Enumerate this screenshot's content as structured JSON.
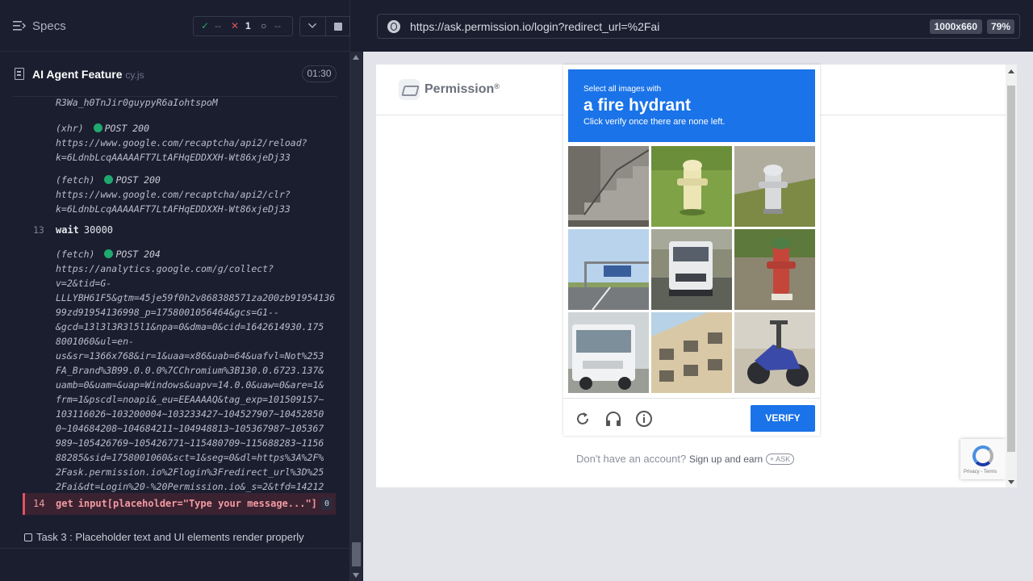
{
  "reporter": {
    "specs_label": "Specs",
    "stats": {
      "passed": "--",
      "failed": "1",
      "pending": "--"
    },
    "spec_file": {
      "name": "AI Agent Feature",
      "ext": "cy.js",
      "duration": "01:30"
    },
    "log": [
      {
        "type": "text",
        "text": "R3Wa_h0TnJir0guypyR6aIohtspoM"
      },
      {
        "type": "req",
        "label": "(xhr)",
        "status": "POST 200"
      },
      {
        "type": "text",
        "text": "https://www.google.com/recaptcha/api2/reload?"
      },
      {
        "type": "text",
        "text": "k=6LdnbLcqAAAAAFT7LtAFHqEDDXXH-Wt86xjeDj33"
      },
      {
        "type": "req",
        "label": "(fetch)",
        "status": "POST 200"
      },
      {
        "type": "text",
        "text": "https://www.google.com/recaptcha/api2/clr?"
      },
      {
        "type": "text",
        "text": "k=6LdnbLcqAAAAAFT7LtAFHqEDDXXH-Wt86xjeDj33"
      },
      {
        "type": "cmd",
        "num": "13",
        "name": "wait",
        "arg": "30000"
      },
      {
        "type": "req",
        "label": "(fetch)",
        "status": "POST 204"
      },
      {
        "type": "text",
        "text": "https://analytics.google.com/g/collect?"
      },
      {
        "type": "text",
        "text": "v=2&tid=G-"
      },
      {
        "type": "text",
        "text": "LLLYBH61F5&gtm=45je59f0h2v868388571za200zb91954136"
      },
      {
        "type": "text",
        "text": "99zd91954136998_p=1758001056464&gcs=G1--"
      },
      {
        "type": "text",
        "text": "&gcd=13l3l3R3l5l1&npa=0&dma=0&cid=1642614930.175"
      },
      {
        "type": "text",
        "text": "8001060&ul=en-"
      },
      {
        "type": "text",
        "text": "us&sr=1366x768&ir=1&uaa=x86&uab=64&uafvl=Not%253"
      },
      {
        "type": "text",
        "text": "FA_Brand%3B99.0.0.0%7CChromium%3B130.0.6723.137&"
      },
      {
        "type": "text",
        "text": "uamb=0&uam=&uap=Windows&uapv=14.0.0&uaw=0&are=1&"
      },
      {
        "type": "text",
        "text": "frm=1&pscdl=noapi&_eu=EEAAAAQ&tag_exp=101509157~"
      },
      {
        "type": "text",
        "text": "103116026~103200004~103233427~104527907~10452850"
      },
      {
        "type": "text",
        "text": "0~104684208~104684211~104948813~105367987~105367"
      },
      {
        "type": "text",
        "text": "989~105426769~105426771~115480709~115688283~1156"
      },
      {
        "type": "text",
        "text": "88285&sid=1758001060&sct=1&seg=0&dl=https%3A%2F%"
      },
      {
        "type": "text",
        "text": "2Fask.permission.io%2Flogin%3Fredirect_url%3D%25"
      },
      {
        "type": "text",
        "text": "2Fai&dt=Login%20-%20Permission.io&_s=2&tfd=14212"
      }
    ],
    "error_cmd": {
      "num": "14",
      "name": "get",
      "arg": "input[placeholder=\"Type your message...\"]",
      "count": "0"
    },
    "task_label": "Task 3 : Placeholder text and UI elements render properly"
  },
  "browser": {
    "url": "https://ask.permission.io/login?redirect_url=%2Fai",
    "viewport": "1000x660",
    "zoom": "79%"
  },
  "site": {
    "logo_text": "Permission",
    "logo_reg": "®",
    "signup_prompt": "Don't have an account?",
    "signup_link": "Sign up and earn",
    "ask_badge": "+ ASK",
    "recaptcha_terms": "Privacy - Terms"
  },
  "captcha": {
    "line1": "Select all images with",
    "object": "a fire hydrant",
    "line3": "Click verify once there are none left.",
    "verify_label": "VERIFY",
    "tiles": [
      "stairs",
      "hydrant-yellow",
      "hydrant-silver",
      "highway-sign",
      "truck",
      "hydrant-red",
      "truck-white",
      "building",
      "motorbike"
    ]
  },
  "colors": {
    "accent": "#1a73e8",
    "pass": "#1fa971",
    "fail": "#e05261"
  }
}
